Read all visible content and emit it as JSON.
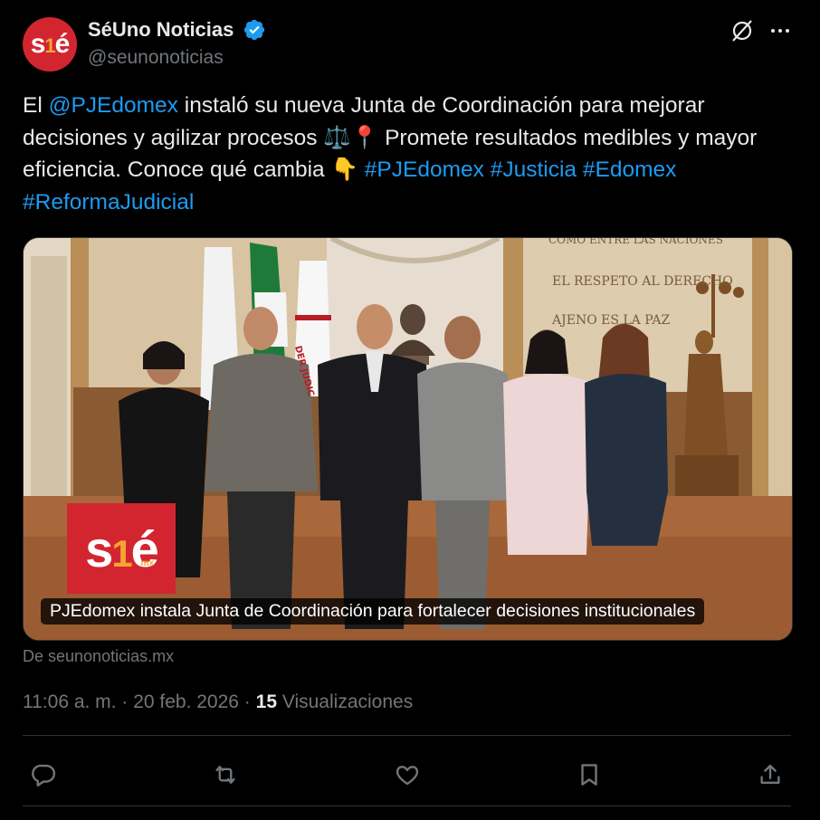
{
  "author": {
    "display_name": "SéUno Noticias",
    "handle": "@seunonoticias",
    "avatar_text": {
      "left": "s",
      "mid": "1",
      "right": "é"
    },
    "verified_icon": "verified-badge-icon"
  },
  "tweet": {
    "segments": [
      {
        "text": "El ",
        "type": "text"
      },
      {
        "text": "@PJEdomex",
        "type": "mention"
      },
      {
        "text": " instaló su nueva Junta de Coordinación para mejorar decisiones y agilizar procesos ⚖️📍 Promete resultados medibles y mayor eficiencia. Conoce qué cambia 👇 ",
        "type": "text"
      },
      {
        "text": "#PJEdomex",
        "type": "hashtag"
      },
      {
        "text": " ",
        "type": "text"
      },
      {
        "text": "#Justicia",
        "type": "hashtag"
      },
      {
        "text": " ",
        "type": "text"
      },
      {
        "text": "#Edomex",
        "type": "hashtag"
      },
      {
        "text": " ",
        "type": "text"
      },
      {
        "text": "#ReformaJudicial",
        "type": "hashtag"
      }
    ]
  },
  "media": {
    "caption": "PJEdomex instala Junta de Coordinación para fortalecer decisiones institucionales",
    "logo": {
      "left": "s",
      "mid": "1",
      "right": "é",
      "sub": "mx"
    },
    "wall_text": [
      "COMO ENTRE LAS NACIONES",
      "EL RESPETO AL DERECHO",
      "AJENO ES LA PAZ"
    ],
    "flag_text": "DER JUDIC"
  },
  "source": "De seunonoticias.mx",
  "meta": {
    "time": "11:06 a. m.",
    "separator": " · ",
    "date": "20 feb. 2026",
    "views_count": "15",
    "views_label": " Visualizaciones"
  },
  "actions": [
    {
      "name": "reply",
      "icon": "reply-icon"
    },
    {
      "name": "repost",
      "icon": "repost-icon"
    },
    {
      "name": "like",
      "icon": "heart-icon"
    },
    {
      "name": "bookmark",
      "icon": "bookmark-icon"
    },
    {
      "name": "share",
      "icon": "share-icon"
    }
  ],
  "colors": {
    "background": "#000000",
    "text": "#e7e9ea",
    "muted": "#71767b",
    "link": "#1d9bf0",
    "brand_red": "#d32530",
    "brand_orange": "#f3a531"
  }
}
